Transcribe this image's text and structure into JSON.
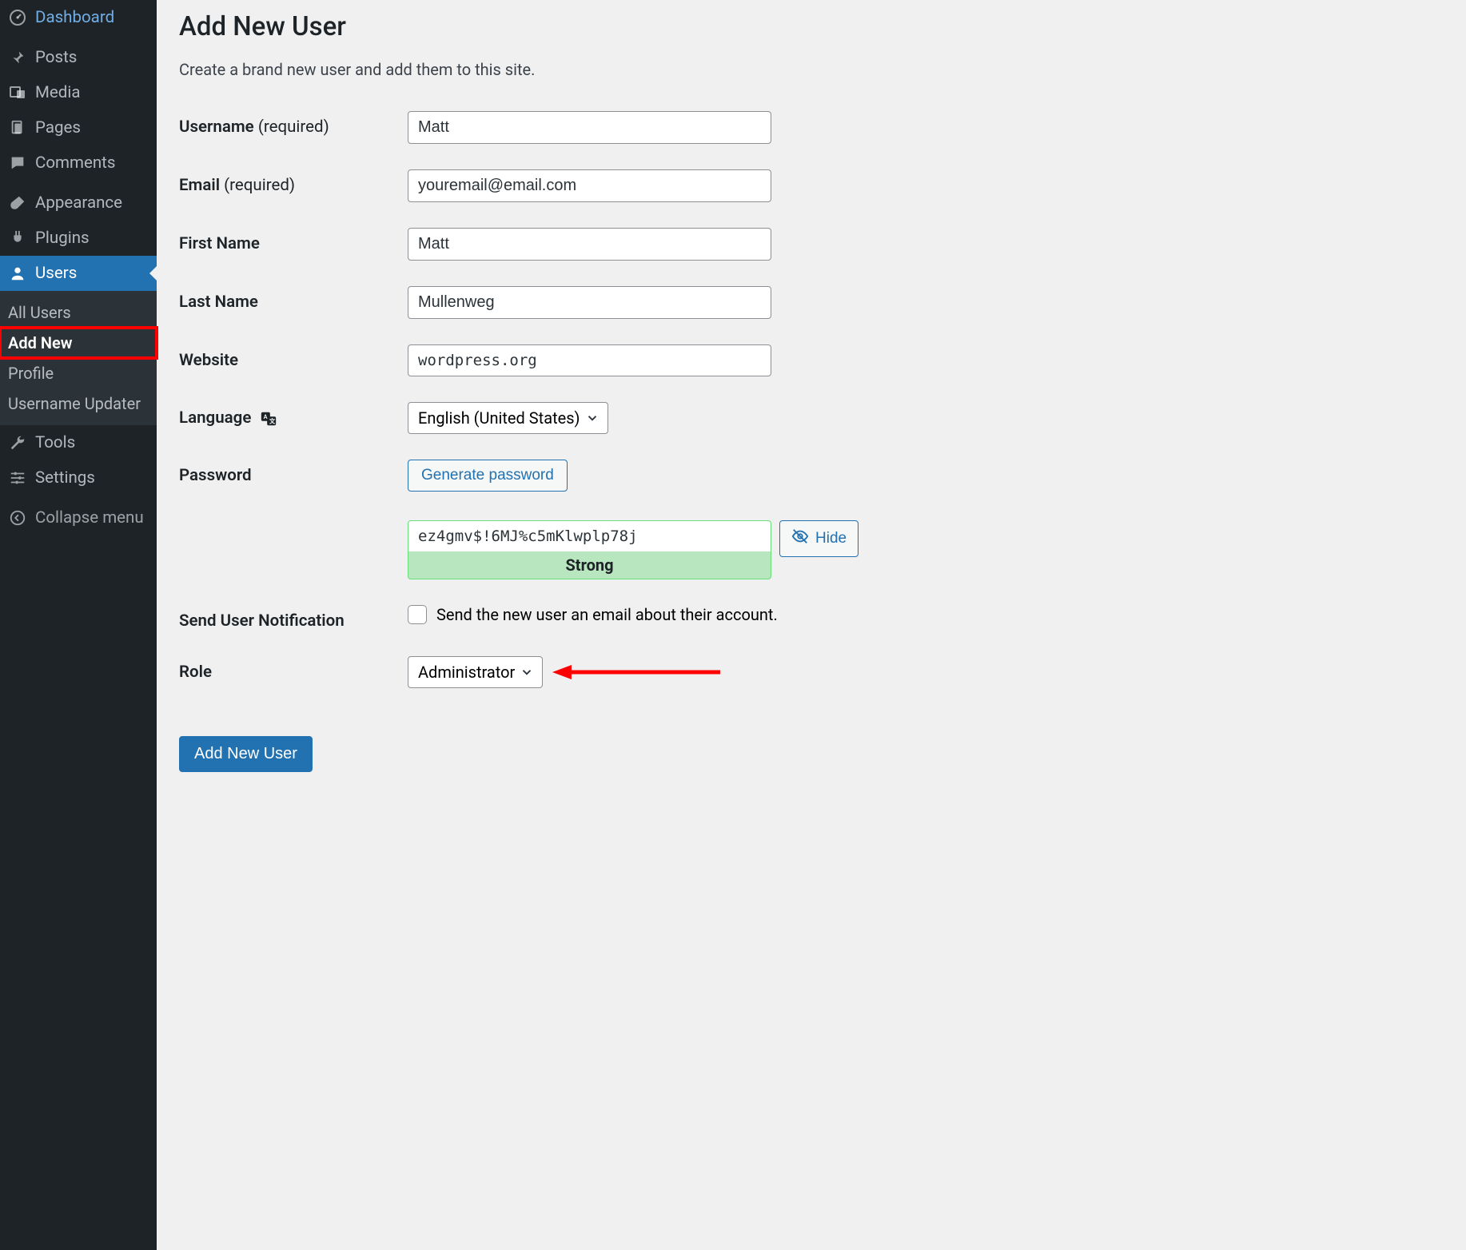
{
  "sidebar": {
    "items": [
      {
        "label": "Dashboard",
        "icon": "dashboard"
      },
      {
        "label": "Posts",
        "icon": "pin"
      },
      {
        "label": "Media",
        "icon": "media"
      },
      {
        "label": "Pages",
        "icon": "pages"
      },
      {
        "label": "Comments",
        "icon": "comment"
      },
      {
        "label": "Appearance",
        "icon": "brush"
      },
      {
        "label": "Plugins",
        "icon": "plug"
      },
      {
        "label": "Users",
        "icon": "user",
        "active": true
      },
      {
        "label": "Tools",
        "icon": "wrench"
      },
      {
        "label": "Settings",
        "icon": "sliders"
      }
    ],
    "submenu": [
      {
        "label": "All Users"
      },
      {
        "label": "Add New",
        "current": true,
        "highlighted": true
      },
      {
        "label": "Profile"
      },
      {
        "label": "Username Updater"
      }
    ],
    "collapse_label": "Collapse menu"
  },
  "page": {
    "title": "Add New User",
    "subtitle": "Create a brand new user and add them to this site."
  },
  "form": {
    "username": {
      "label": "Username",
      "required_label": "(required)",
      "value": "Matt"
    },
    "email": {
      "label": "Email",
      "required_label": "(required)",
      "value": "youremail@email.com"
    },
    "first_name": {
      "label": "First Name",
      "value": "Matt"
    },
    "last_name": {
      "label": "Last Name",
      "value": "Mullenweg"
    },
    "website": {
      "label": "Website",
      "value": "wordpress.org"
    },
    "language": {
      "label": "Language",
      "value": "English (United States)"
    },
    "password": {
      "label": "Password",
      "generate_label": "Generate password",
      "value": "ez4gmv$!6MJ%c5mKlwplp78j",
      "strength_label": "Strong",
      "hide_label": "Hide"
    },
    "notification": {
      "label": "Send User Notification",
      "checkbox_label": "Send the new user an email about their account."
    },
    "role": {
      "label": "Role",
      "value": "Administrator"
    },
    "submit_label": "Add New User"
  }
}
